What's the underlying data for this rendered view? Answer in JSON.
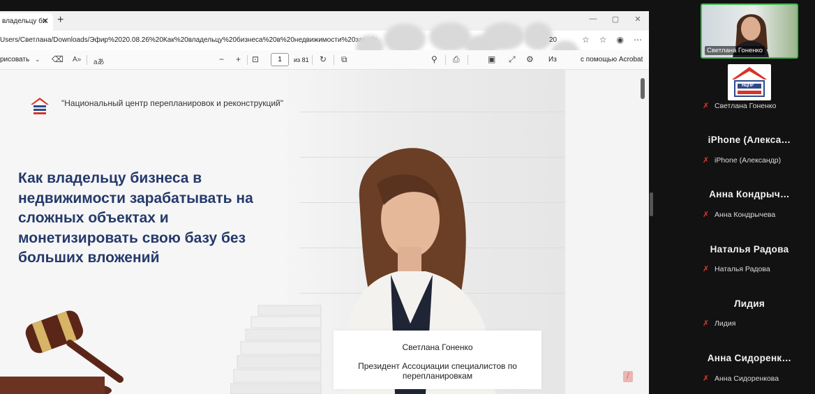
{
  "browser": {
    "tab_title": "владельцу би",
    "tab_close": "✕",
    "new_tab": "+",
    "window_controls": [
      "—",
      "▢",
      "✕"
    ],
    "url": "Users/Светлана/Downloads/Эфир%2020.08.26%20Как%20владельцу%20бизнеса%20в%20недвижимости%20зарабаты",
    "url_tail": "20",
    "addr_icons": [
      "☆",
      "☆",
      "◉",
      "⋯"
    ]
  },
  "pdf_toolbar": {
    "draw_label": "рисовать",
    "page_current": "1",
    "page_total": "из 81",
    "zoom_out": "−",
    "zoom_in": "+",
    "open_with": "Из",
    "open_with_tail": "с помощью Acrobat"
  },
  "slide": {
    "org_name": "\"Национальный центр перепланировок и реконструкций\"",
    "headline_lines": [
      "Как владельцу бизнеса в",
      "недвижимости зарабатывать на",
      "сложных объектах и",
      "монетизировать свою базу без",
      "больших вложений"
    ],
    "speaker_name": "Светлана Гоненко",
    "speaker_role_lines": [
      "Президент Ассоциации специалистов по",
      "перепланировкам"
    ]
  },
  "meeting": {
    "self_video_label": "Светлана Гоненко",
    "org_tile_text": "НЦПР",
    "participants": [
      {
        "title": "",
        "sub": "Светлана Гоненко"
      },
      {
        "title": "iPhone (Алекса…",
        "sub": "iPhone (Александр)"
      },
      {
        "title": "Анна Кондрыч…",
        "sub": "Анна Кондрычева"
      },
      {
        "title": "Наталья Радова",
        "sub": "Наталья Радова"
      },
      {
        "title": "Лидия",
        "sub": "Лидия"
      },
      {
        "title": "Анна Сидоренк…",
        "sub": "Анна Сидоренкова"
      }
    ],
    "mic_icon": "mic-off-icon"
  },
  "colors": {
    "headline": "#253a6b",
    "active_speaker_border": "#3dbf4a",
    "muted_mic": "#e0382f"
  }
}
